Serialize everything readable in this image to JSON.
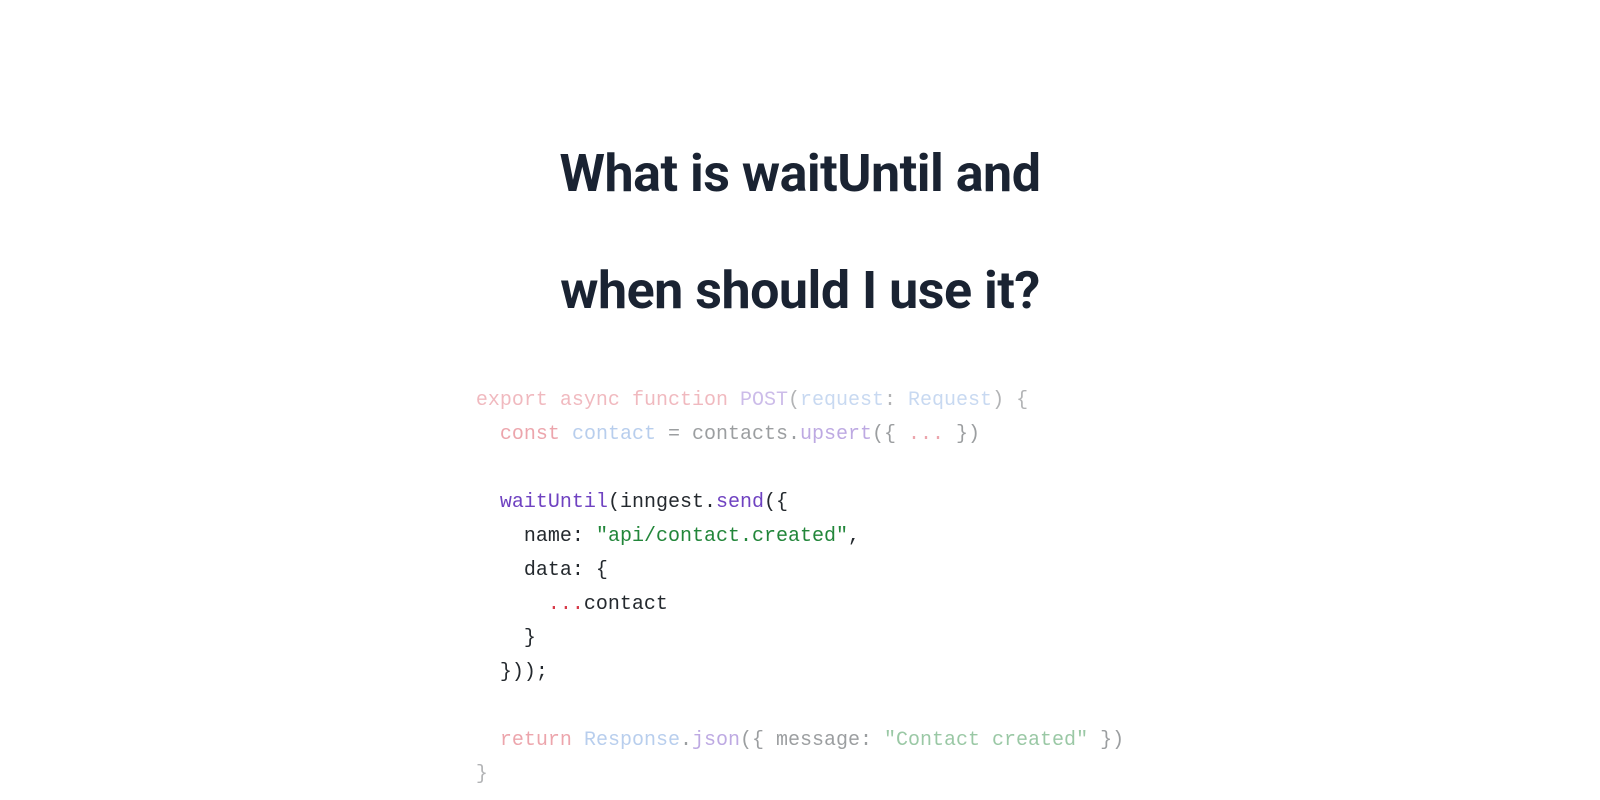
{
  "title": {
    "line1": "What is waitUntil and",
    "line2": "when should I use it?"
  },
  "code": {
    "tokens": [
      {
        "text": "export",
        "class": "kw-red faded"
      },
      {
        "text": " ",
        "class": ""
      },
      {
        "text": "async",
        "class": "kw-red faded"
      },
      {
        "text": " ",
        "class": ""
      },
      {
        "text": "function",
        "class": "kw-red faded"
      },
      {
        "text": " ",
        "class": ""
      },
      {
        "text": "POST",
        "class": "kw-purple faded"
      },
      {
        "text": "(",
        "class": "faded"
      },
      {
        "text": "request",
        "class": "var-name faded"
      },
      {
        "text": ": ",
        "class": "faded"
      },
      {
        "text": "Request",
        "class": "kw-blue faded"
      },
      {
        "text": ")",
        "class": "faded"
      },
      {
        "text": " {",
        "class": "faded"
      },
      {
        "text": "\n  ",
        "class": ""
      },
      {
        "text": "const",
        "class": "kw-red faded-2"
      },
      {
        "text": " ",
        "class": ""
      },
      {
        "text": "contact",
        "class": "var-name faded-2"
      },
      {
        "text": " = ",
        "class": "faded-2"
      },
      {
        "text": "contacts",
        "class": "punct faded-2"
      },
      {
        "text": ".",
        "class": "faded-2"
      },
      {
        "text": "upsert",
        "class": "kw-purple faded-2"
      },
      {
        "text": "({ ",
        "class": "faded-2"
      },
      {
        "text": "...",
        "class": "kw-red faded-2"
      },
      {
        "text": " })",
        "class": "faded-2"
      },
      {
        "text": "\n\n  ",
        "class": ""
      },
      {
        "text": "waitUntil",
        "class": "kw-purple"
      },
      {
        "text": "(",
        "class": ""
      },
      {
        "text": "inngest",
        "class": "punct"
      },
      {
        "text": ".",
        "class": ""
      },
      {
        "text": "send",
        "class": "kw-purple"
      },
      {
        "text": "({",
        "class": ""
      },
      {
        "text": "\n    ",
        "class": ""
      },
      {
        "text": "name",
        "class": "punct"
      },
      {
        "text": ": ",
        "class": ""
      },
      {
        "text": "\"api/contact.created\"",
        "class": "kw-green"
      },
      {
        "text": ",",
        "class": ""
      },
      {
        "text": "\n    ",
        "class": ""
      },
      {
        "text": "data",
        "class": "punct"
      },
      {
        "text": ": {",
        "class": ""
      },
      {
        "text": "\n      ",
        "class": ""
      },
      {
        "text": "...",
        "class": "kw-red"
      },
      {
        "text": "contact",
        "class": "punct"
      },
      {
        "text": "\n    }",
        "class": ""
      },
      {
        "text": "\n  }));",
        "class": ""
      },
      {
        "text": "\n\n  ",
        "class": ""
      },
      {
        "text": "return",
        "class": "kw-red faded-2"
      },
      {
        "text": " ",
        "class": ""
      },
      {
        "text": "Response",
        "class": "kw-blue faded-2"
      },
      {
        "text": ".",
        "class": "faded-2"
      },
      {
        "text": "json",
        "class": "kw-purple faded-2"
      },
      {
        "text": "({ ",
        "class": "faded-2"
      },
      {
        "text": "message",
        "class": "punct faded-2"
      },
      {
        "text": ": ",
        "class": "faded-2"
      },
      {
        "text": "\"Contact created\"",
        "class": "kw-green faded-2"
      },
      {
        "text": " })",
        "class": "faded-2"
      },
      {
        "text": "\n}",
        "class": "faded"
      }
    ]
  }
}
